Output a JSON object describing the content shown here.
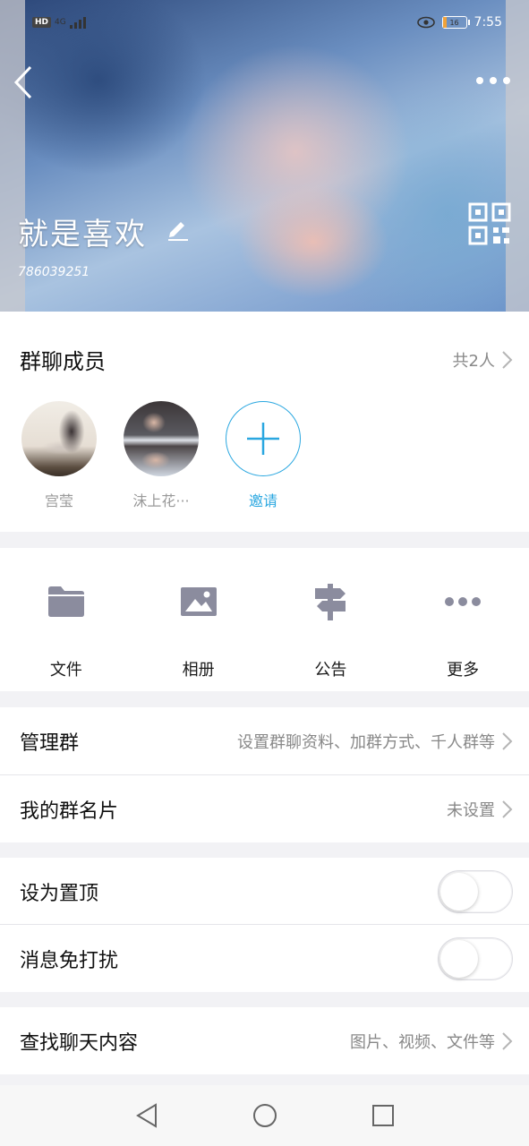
{
  "status_bar": {
    "hd": "HD",
    "network": "4G",
    "battery_percent": 16,
    "battery_text": "16",
    "time": "7:55"
  },
  "header": {
    "group_name": "就是喜欢",
    "group_id": "786039251"
  },
  "members": {
    "title": "群聊成员",
    "count_label": "共2人",
    "list": [
      {
        "name": "宫莹"
      },
      {
        "name": "沫上花···"
      }
    ],
    "invite_label": "邀请"
  },
  "actions": [
    {
      "label": "文件",
      "icon": "folder-icon"
    },
    {
      "label": "相册",
      "icon": "image-icon"
    },
    {
      "label": "公告",
      "icon": "signpost-icon"
    },
    {
      "label": "更多",
      "icon": "more-dots-icon"
    }
  ],
  "settings": {
    "manage_group": {
      "label": "管理群",
      "value": "设置群聊资料、加群方式、千人群等"
    },
    "my_card": {
      "label": "我的群名片",
      "value": "未设置"
    },
    "pin_top": {
      "label": "设为置顶",
      "on": false
    },
    "mute": {
      "label": "消息免打扰",
      "on": false
    },
    "search_chat": {
      "label": "查找聊天内容",
      "value": "图片、视频、文件等"
    }
  },
  "colors": {
    "accent": "#2aa7e0",
    "icon_gray": "#8b8c9e",
    "divider": "#e5e5ea"
  }
}
